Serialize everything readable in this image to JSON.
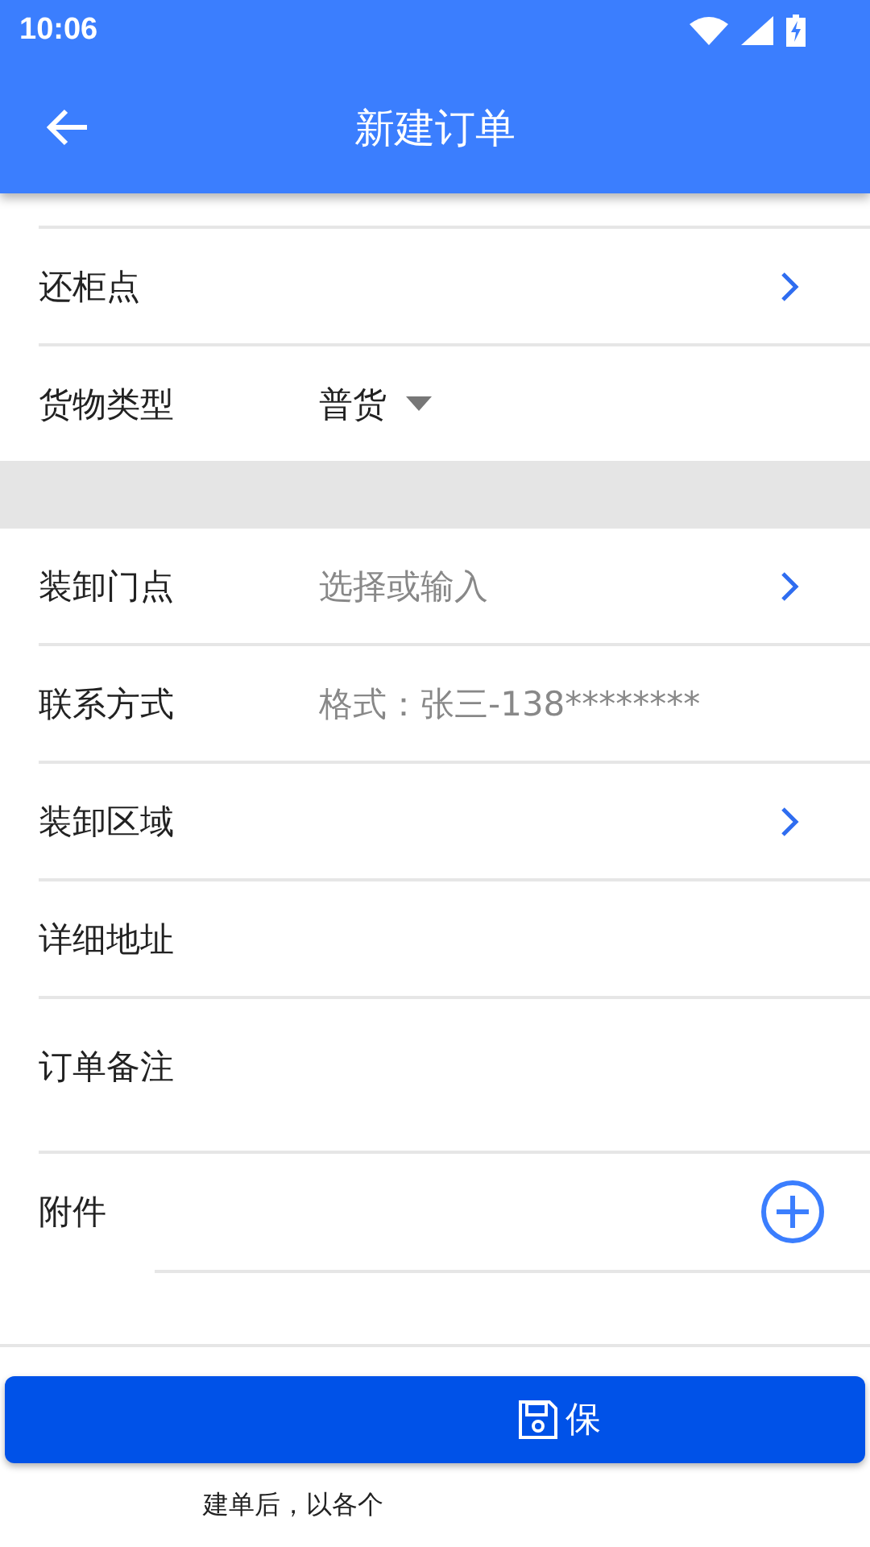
{
  "status_bar": {
    "time": "10:06"
  },
  "app_bar": {
    "title": "新建订单"
  },
  "sections": [
    {
      "rows": [
        {
          "kind": "link",
          "label": "还柜点"
        },
        {
          "kind": "select",
          "label": "货物类型",
          "value": "普货"
        }
      ]
    },
    {
      "rows": [
        {
          "kind": "link",
          "label": "装卸门点",
          "placeholder": "选择或输入"
        },
        {
          "kind": "input",
          "label": "联系方式",
          "placeholder": "格式：张三-138********"
        },
        {
          "kind": "link",
          "label": "装卸区域"
        },
        {
          "kind": "input",
          "label": "详细地址"
        },
        {
          "kind": "textarea",
          "label": "订单备注"
        },
        {
          "kind": "attach",
          "label": "附件"
        }
      ]
    }
  ],
  "save_button": {
    "label": "保"
  },
  "note": "建单后，以各个"
}
